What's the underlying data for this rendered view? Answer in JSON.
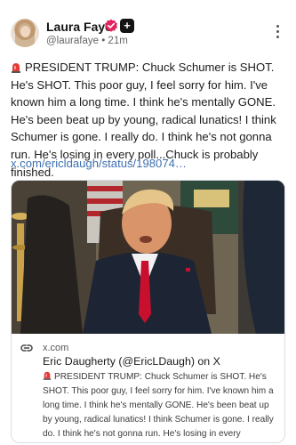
{
  "author": {
    "name": "Laura Faye",
    "handle": "@laurafaye",
    "separator": "•",
    "time": "21m",
    "badge_plus": "+"
  },
  "post": {
    "text": "PRESIDENT TRUMP: Chuck Schumer is SHOT. He's SHOT. This poor guy, I feel sorry for him. I've known him a long time. I think he's mentally GONE. He's been beat up by young, radical lunatics! I think Schumer is gone. I really do. I think he's not gonna run. He's losing in every poll...Chuck is probably finished.",
    "link": "x.com/ericldaugh/status/198074…"
  },
  "link_card": {
    "domain": "x.com",
    "title": "Eric Daugherty (@EricLDaugh) on X",
    "description": "PRESIDENT TRUMP: Chuck Schumer is SHOT. He's SHOT. This poor guy, I feel sorry for him. I've known him a long time. I think he's mentally GONE. He's been beat up by young, radical lunatics! I think Schumer is gone. I really do. I think he's not gonna run. He's losing in every"
  },
  "colors": {
    "link": "#3e6fb0",
    "verified": "#e0245e",
    "text": "#1c1c1c",
    "muted": "#666666"
  },
  "icons": [
    "verified-badge-icon",
    "plus-badge-icon",
    "more-options-icon",
    "siren-emoji-icon",
    "link-icon"
  ]
}
